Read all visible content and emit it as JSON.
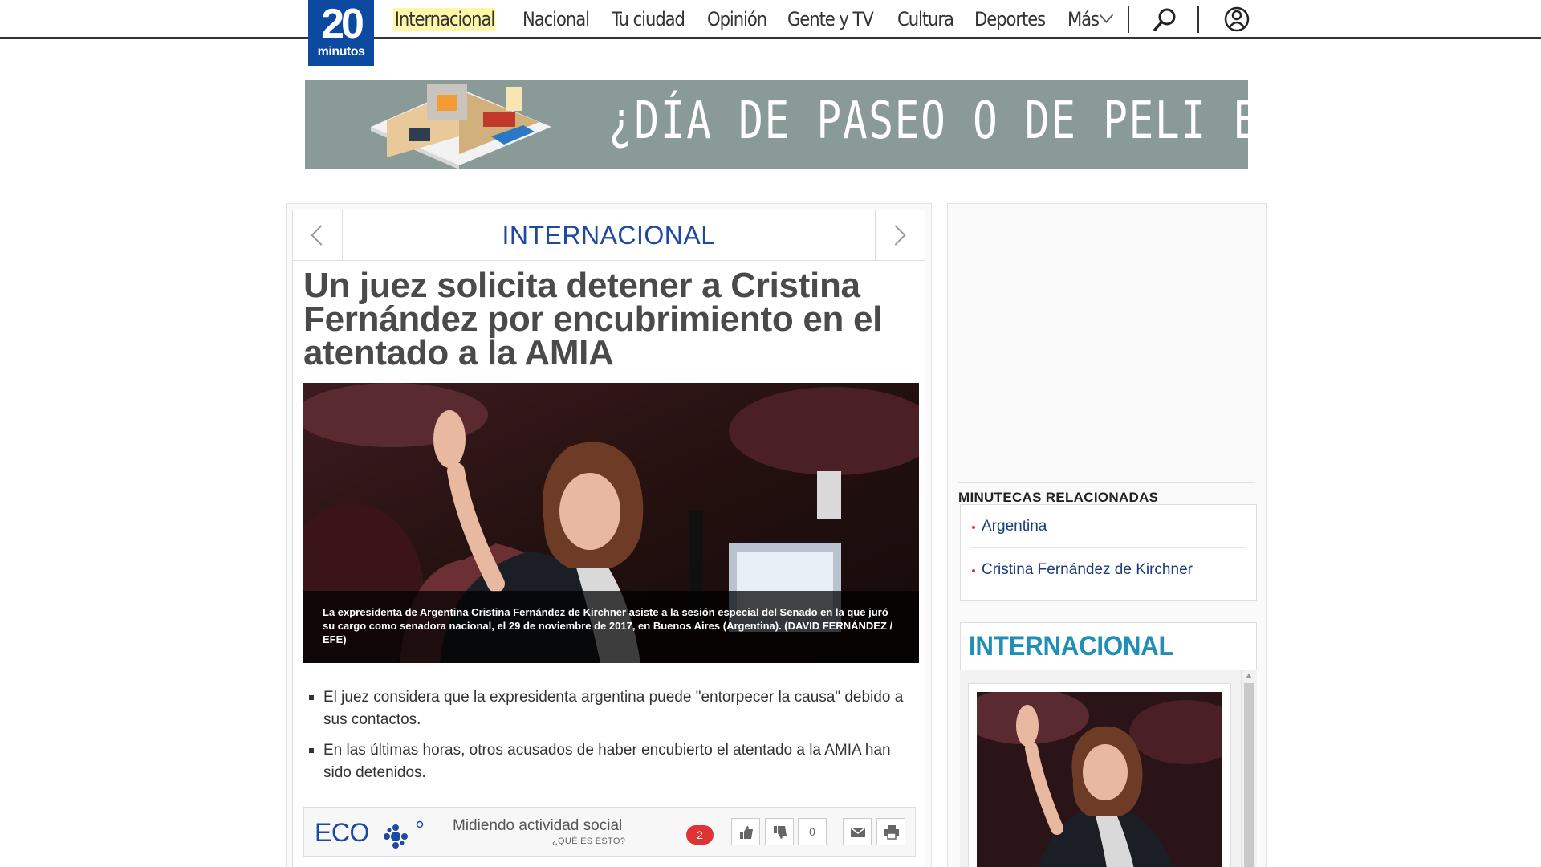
{
  "logo": {
    "number": "20",
    "word": "minutos"
  },
  "nav": {
    "items": [
      "Internacional",
      "Nacional",
      "Tu ciudad",
      "Opinión",
      "Gente y TV",
      "Cultura",
      "Deportes",
      "Más"
    ],
    "active_index": 0
  },
  "banner": {
    "text": "¿DÍA DE PASEO O DE PELI EN CASA?"
  },
  "section": {
    "title": "INTERNACIONAL"
  },
  "article": {
    "headline": "Un juez solicita detener a Cristina Fernández por encubrimiento en el atentado a la AMIA",
    "caption": "La expresidenta de Argentina Cristina Fernández de Kirchner asiste a la sesión especial del Senado en la que juró su cargo como senadora nacional, el 29 de noviembre de 2017, en Buenos Aires (Argentina). (DAVID FERNÁNDEZ / EFE)",
    "bullets": [
      "El juez considera que la expresidenta argentina puede \"entorpecer la causa\" debido a sus contactos.",
      "En las últimas horas, otros acusados de haber encubierto el atentado a la AMIA han sido detenidos."
    ]
  },
  "eco": {
    "logo": "ECO",
    "text": "Midiendo actividad social",
    "sub": "¿QUÉ ES ESTO?",
    "badge": "2",
    "dislike_count": "0"
  },
  "sidebar": {
    "related_title": "MINUTECAS RELACIONADAS",
    "related": [
      "Argentina",
      "Cristina Fernández de Kirchner"
    ],
    "section_title": "INTERNACIONAL"
  },
  "colors": {
    "brand": "#0b4a9f",
    "section_blue": "#1d4aa0",
    "teal": "#1f8fb5",
    "highlight": "#fff7a8",
    "badge": "#dd3333"
  }
}
